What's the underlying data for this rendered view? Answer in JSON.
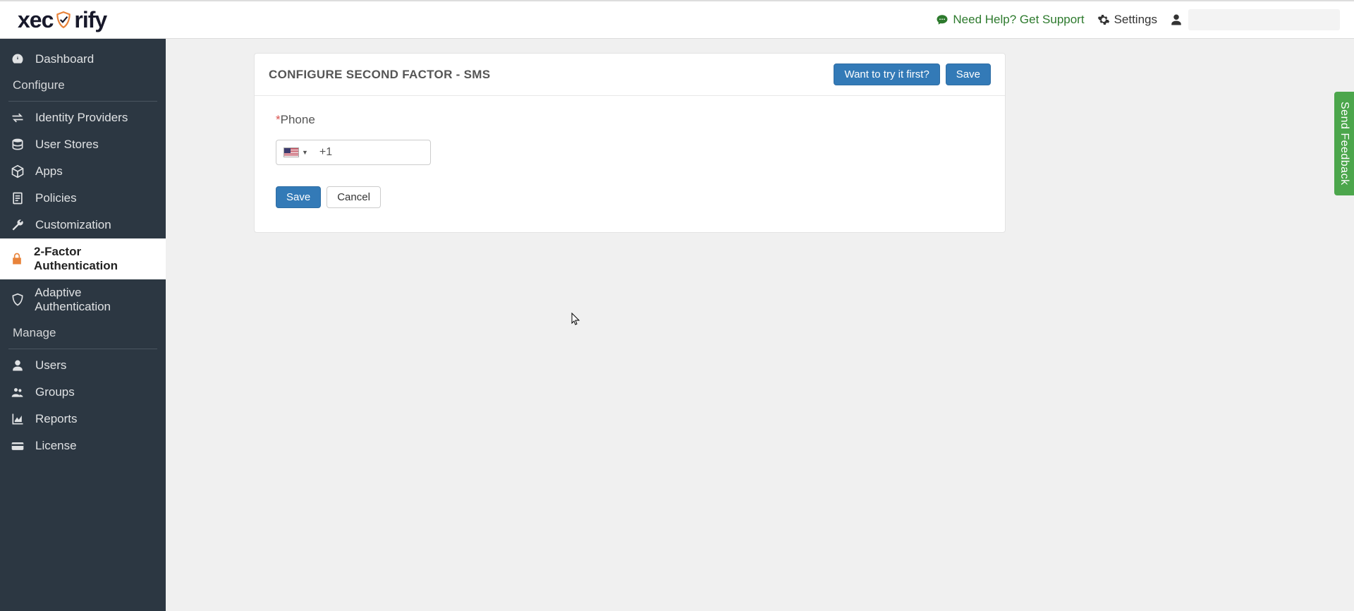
{
  "brand": {
    "part1": "xec",
    "part2": "rify"
  },
  "header": {
    "help_label": "Need Help? Get Support",
    "settings_label": "Settings"
  },
  "sidebar": {
    "items": [
      {
        "label": "Dashboard"
      },
      {
        "label": "Identity Providers"
      },
      {
        "label": "User Stores"
      },
      {
        "label": "Apps"
      },
      {
        "label": "Policies"
      },
      {
        "label": "Customization"
      },
      {
        "label": "2-Factor Authentication"
      },
      {
        "label": "Adaptive Authentication"
      },
      {
        "label": "Users"
      },
      {
        "label": "Groups"
      },
      {
        "label": "Reports"
      },
      {
        "label": "License"
      }
    ],
    "section_configure": "Configure",
    "section_manage": "Manage"
  },
  "panel": {
    "title": "CONFIGURE SECOND FACTOR - SMS",
    "try_label": "Want to try it first?",
    "save_label": "Save"
  },
  "form": {
    "phone_label": "Phone",
    "country_code": "+1",
    "save_label": "Save",
    "cancel_label": "Cancel"
  },
  "feedback": {
    "label": "Send Feedback"
  }
}
